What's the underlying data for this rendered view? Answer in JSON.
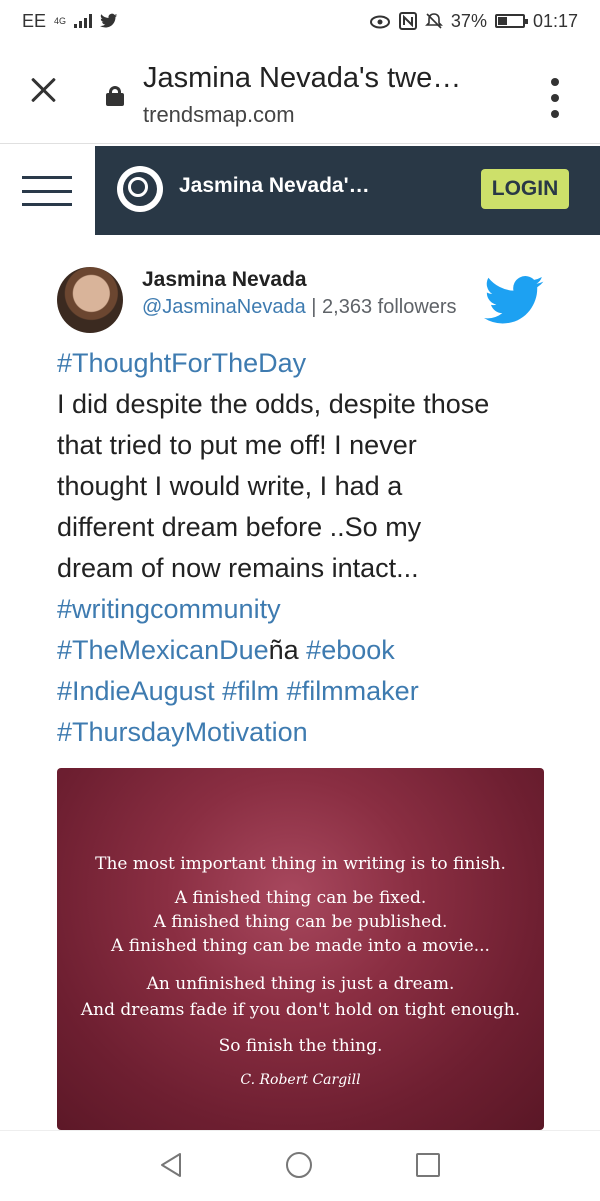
{
  "status_bar": {
    "carrier": "EE",
    "network": "4G",
    "battery": "37%",
    "battery_level": 0.37,
    "time": "01:17",
    "icons": [
      "signal-icon",
      "twitter-notification-icon",
      "eye-comfort-icon",
      "nfc-icon",
      "mute-icon",
      "battery-icon"
    ]
  },
  "browser": {
    "title": "Jasmina Nevada's twe…",
    "url": "trendsmap.com",
    "icons": [
      "close-icon",
      "lock-icon",
      "more-menu-icon"
    ]
  },
  "site_header": {
    "title": "Jasmina Nevada'…",
    "login_label": "LOGIN",
    "icons": [
      "hamburger-menu-icon",
      "trendsmap-logo-icon"
    ],
    "colors": {
      "header_bg": "#293846",
      "login_bg": "#cde06a"
    }
  },
  "tweet": {
    "name": "Jasmina Nevada",
    "handle": "@JasminaNevada",
    "followers": " | 2,363 followers",
    "lines": [
      [
        {
          "t": "#ThoughtForTheDay",
          "tag": true
        }
      ],
      [
        {
          "t": "I did despite the odds, despite those",
          "tag": false
        }
      ],
      [
        {
          "t": "that tried to put me off! I never",
          "tag": false
        }
      ],
      [
        {
          "t": "thought I would write, I had a",
          "tag": false
        }
      ],
      [
        {
          "t": "different dream before ..So my",
          "tag": false
        }
      ],
      [
        {
          "t": "dream of now remains intact...",
          "tag": false
        }
      ],
      [
        {
          "t": "#writingcommunity",
          "tag": true
        }
      ],
      [
        {
          "t": "#TheMexicanDue",
          "tag": true
        },
        {
          "t": "ña ",
          "tag": false
        },
        {
          "t": "#ebook",
          "tag": true
        }
      ],
      [
        {
          "t": "#IndieAugust",
          "tag": true
        },
        {
          "t": " ",
          "tag": false
        },
        {
          "t": "#film",
          "tag": true
        },
        {
          "t": " ",
          "tag": false
        },
        {
          "t": "#filmmaker",
          "tag": true
        }
      ],
      [
        {
          "t": "#ThursdayMotivation",
          "tag": true
        }
      ]
    ],
    "colors": {
      "hashtag": "#3e7bb0",
      "twitter_blue": "#1da1f2"
    }
  },
  "quote_image": {
    "lines": [
      "The most important thing in writing is to finish.",
      "A finished thing can be fixed.",
      "A finished thing can be published.",
      "A finished thing can be made into a movie...",
      "An unfinished thing is just a dream.",
      "And dreams fade if you don't hold on tight enough.",
      "So finish the thing."
    ],
    "author": "C. Robert Cargill"
  },
  "nav_bar": {
    "icons": [
      "back-icon",
      "home-icon",
      "recent-apps-icon"
    ]
  }
}
